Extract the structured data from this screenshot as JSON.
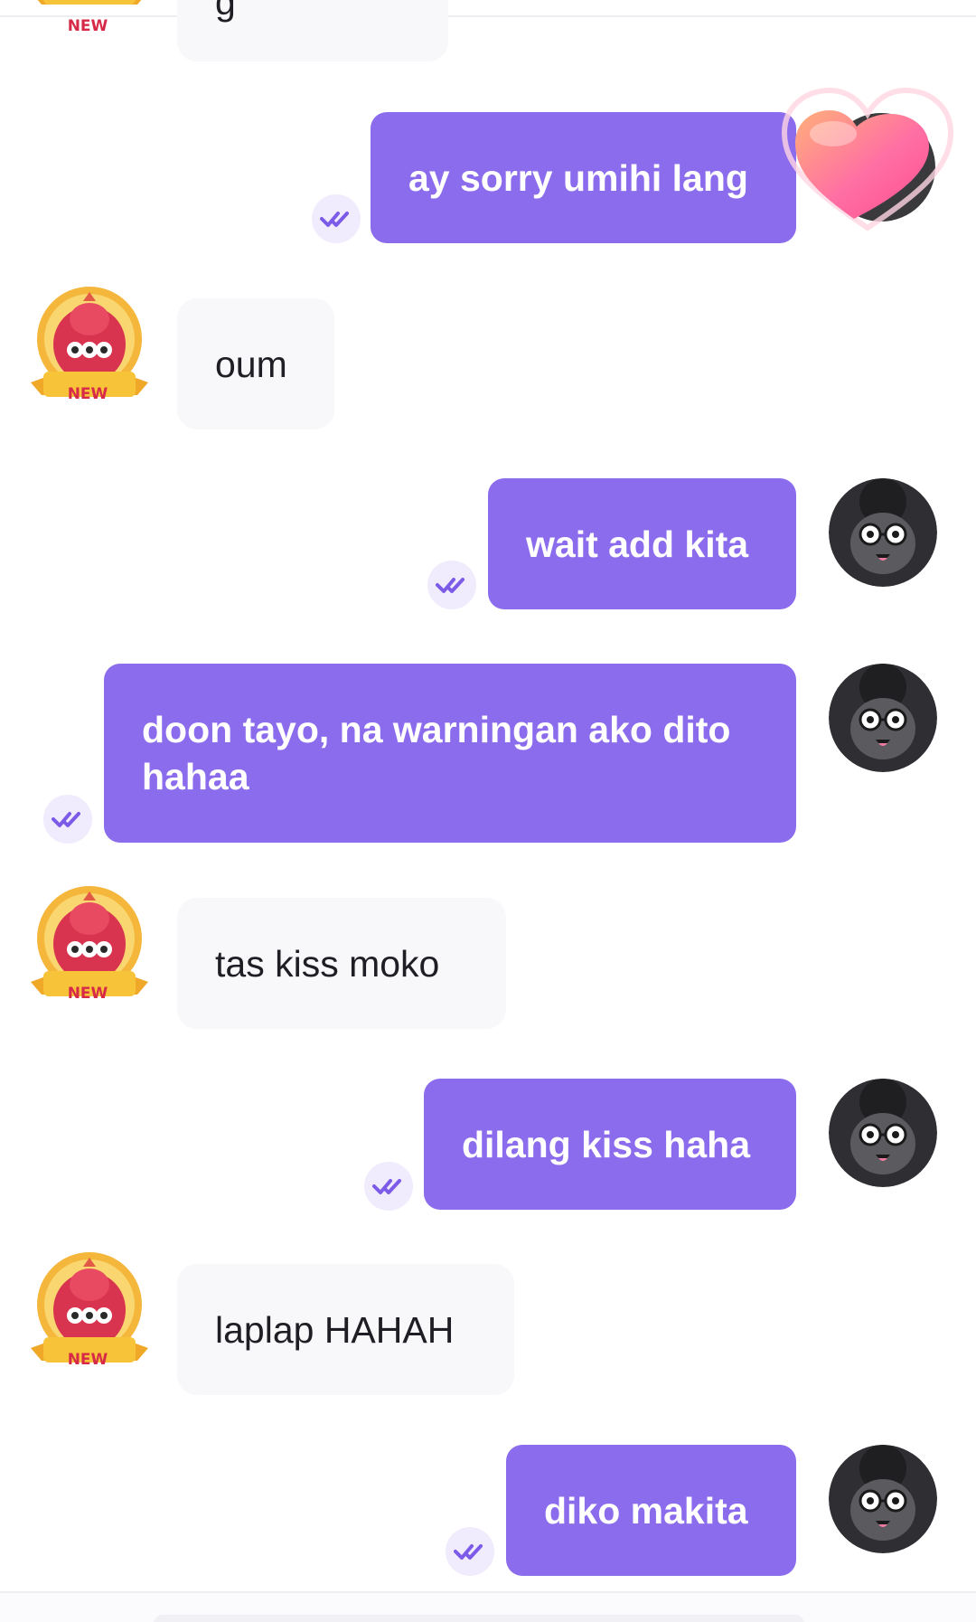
{
  "conversation": {
    "messages": [
      {
        "direction": "incoming",
        "text": "g"
      },
      {
        "direction": "outgoing",
        "text": "ay sorry umihi lang",
        "read": true
      },
      {
        "direction": "incoming",
        "text": "oum"
      },
      {
        "direction": "outgoing",
        "text": "wait add kita",
        "read": true
      },
      {
        "direction": "outgoing",
        "text": "doon tayo, na warningan ako dito hahaa",
        "read": true
      },
      {
        "direction": "incoming",
        "text": "tas kiss moko"
      },
      {
        "direction": "outgoing",
        "text": "dilang kiss haha",
        "read": true
      },
      {
        "direction": "incoming",
        "text": "laplap HAHAH"
      },
      {
        "direction": "outgoing",
        "text": "diko makita",
        "read": true
      }
    ]
  },
  "badges": {
    "new_label": "NEW"
  },
  "colors": {
    "outgoing_bubble": "#8b6ced",
    "incoming_bubble": "#f8f8fb",
    "receipt_bg": "#f0ebfd",
    "receipt_check": "#7b5be8"
  },
  "icons": {
    "receipt": "double-check-icon",
    "frame": "heart-frame-icon",
    "badge": "new-member-badge-icon",
    "avatar": "sheep-avatar-icon"
  }
}
